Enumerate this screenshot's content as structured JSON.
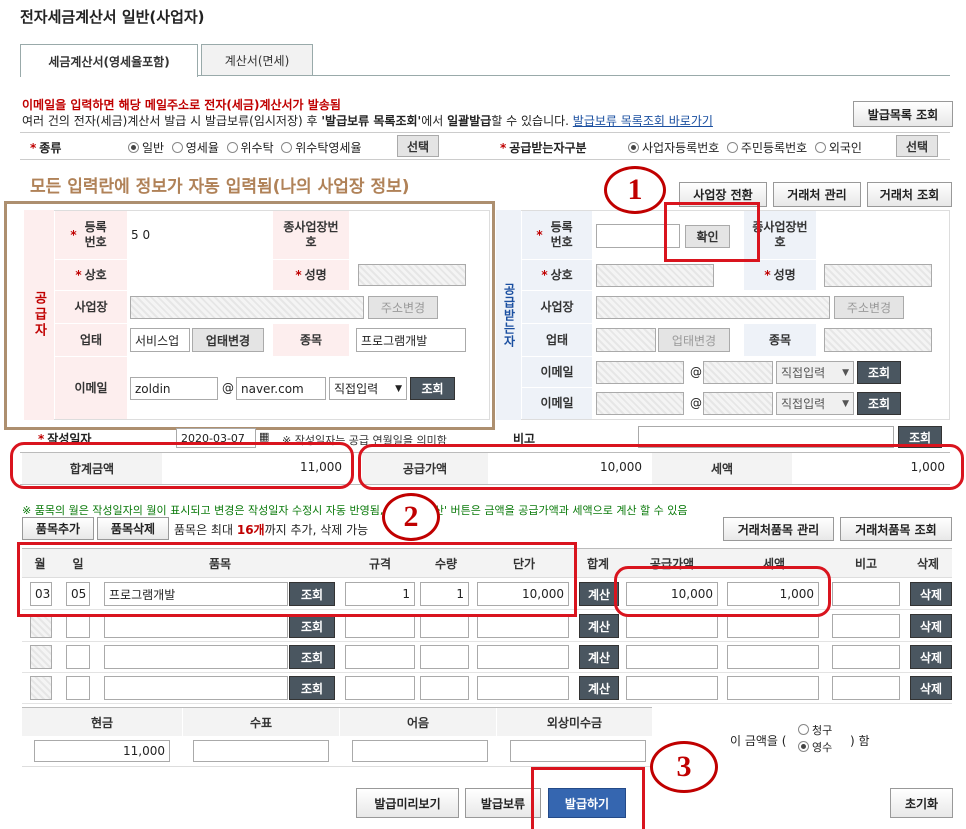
{
  "page_title": "전자세금계산서 일반(사업자)",
  "tabs": [
    "세금계산서(영세율포함)",
    "계산서(면세)"
  ],
  "notice": {
    "line1": "이메일을 입력하면 해당 메일주소로 전자(세금)계산서가 발송됨",
    "line2_a": "여러 건의 전자(세금)계산서 발급 시 발급보류(임시저장) 후 ",
    "line2_b": "'발급보류 목록조회'",
    "line2_c": "에서 ",
    "line2_d": "일괄발급",
    "line2_e": "할 수 있습니다. ",
    "line2_link": "발급보류 목록조회 바로가기",
    "list_button": "발급목록 조회"
  },
  "type_row": {
    "label": "종류",
    "options": [
      "일반",
      "영세율",
      "위수탁",
      "위수탁영세율"
    ],
    "select_button": "선택",
    "recipient_label": "공급받는자구분",
    "recipient_options": [
      "사업자등록번호",
      "주민등록번호",
      "외국인"
    ],
    "recipient_select_button": "선택"
  },
  "auto_notice": "모든 입력란에 정보가 자동 입력됨(나의 사업장 정보)",
  "top_buttons": [
    "사업장 전환",
    "거래처 관리",
    "거래처 조회"
  ],
  "supplier": {
    "side_label": "공급자",
    "reg_label": "등록번호",
    "reg_value": "5           0",
    "sub_label": "종사업장번호",
    "name_label": "상호",
    "name_value": "",
    "ceo_label": "성명",
    "addr_label": "사업장",
    "addr_button": "주소변경",
    "biz_label": "업태",
    "biz_value": "서비스업",
    "biz_button": "업태변경",
    "item_label": "종목",
    "item_value": "프로그램개발",
    "email_label": "이메일",
    "email_id": "zoldin",
    "email_domain": "naver.com",
    "email_select": "직접입력",
    "email_button": "조회"
  },
  "receiver": {
    "side_label": "공급받는자",
    "reg_label": "등록번호",
    "confirm_button": "확인",
    "sub_label": "종사업장번호",
    "name_label": "상호",
    "ceo_label": "성명",
    "addr_label": "사업장",
    "addr_button": "주소변경",
    "biz_label": "업태",
    "biz_button": "업태변경",
    "item_label": "종목",
    "email_label": "이메일",
    "email_select": "직접입력",
    "email_button": "조회"
  },
  "date_row": {
    "label": "작성일자",
    "value": "2020-03-07",
    "note": "※ 작성일자는 공급 연월일을 의미함",
    "remark_label": "비고",
    "remark_button": "조회"
  },
  "totals": {
    "total_label": "합계금액",
    "total_value": "11,000",
    "supply_label": "공급가액",
    "supply_value": "10,000",
    "tax_label": "세액",
    "tax_value": "1,000"
  },
  "item_note": "※ 품목의 월은 작성일자의 월이 표시되고 변경은 작성일자 수정시 자동 반영됨, 합계의 '계산' 버튼은 금액을 공급가액과 세액으로 계산 할 수 있음",
  "item_toolbar": {
    "add": "품목추가",
    "delete": "품목삭제",
    "info_a": "품목은 최대 ",
    "info_b": "16개",
    "info_c": "까지 추가, 삭제 가능",
    "manage": "거래처품목 관리",
    "lookup": "거래처품목 조회"
  },
  "items_header": [
    "월",
    "일",
    "품목",
    "규격",
    "수량",
    "단가",
    "합계",
    "공급가액",
    "세액",
    "비고",
    "삭제"
  ],
  "items": [
    {
      "month": "03",
      "day": "05",
      "name": "프로그램개발",
      "spec": "1",
      "qty": "1",
      "price": "10,000",
      "supply": "10,000",
      "tax": "1,000"
    },
    {
      "month": "",
      "day": "",
      "name": "",
      "spec": "",
      "qty": "",
      "price": "",
      "supply": "",
      "tax": ""
    },
    {
      "month": "",
      "day": "",
      "name": "",
      "spec": "",
      "qty": "",
      "price": "",
      "supply": "",
      "tax": ""
    },
    {
      "month": "",
      "day": "",
      "name": "",
      "spec": "",
      "qty": "",
      "price": "",
      "supply": "",
      "tax": ""
    }
  ],
  "row_buttons": {
    "lookup": "조회",
    "calc": "계산",
    "delete": "삭제"
  },
  "payment": {
    "headers": [
      "현금",
      "수표",
      "어음",
      "외상미수금"
    ],
    "values": [
      "11,000",
      "",
      "",
      ""
    ],
    "amount_text_a": "이 금액을 (",
    "amount_text_b": ") 함",
    "options": [
      "청구",
      "영수"
    ]
  },
  "bottom_buttons": [
    "발급미리보기",
    "발급보류",
    "발급하기"
  ],
  "reset_button": "초기화",
  "markers": [
    "1",
    "2",
    "3"
  ]
}
